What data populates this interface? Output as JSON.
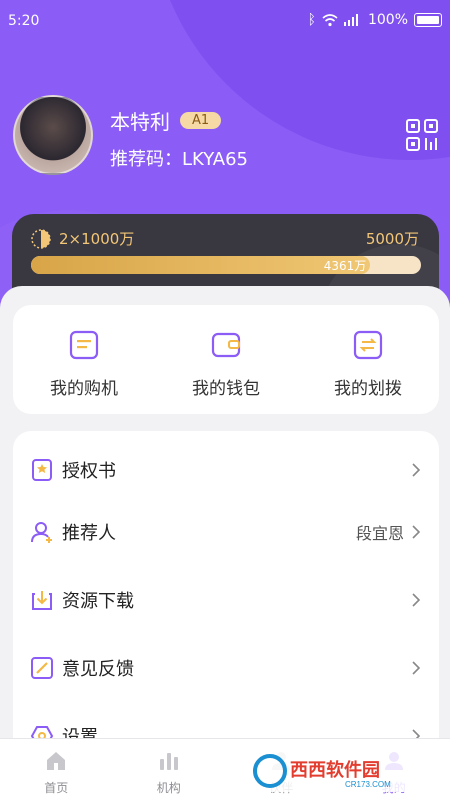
{
  "status": {
    "time": "5:20",
    "battery": "100%"
  },
  "profile": {
    "name": "本特利",
    "level": "A1",
    "referral": "推荐码：LKYA65"
  },
  "membership": {
    "current_label": "2×1000万",
    "target_label": "5000万",
    "progress_label": "4361万",
    "progress_fraction": 0.87
  },
  "quick_actions": [
    {
      "label": "我的购机",
      "icon": "device-icon"
    },
    {
      "label": "我的钱包",
      "icon": "wallet-icon"
    },
    {
      "label": "我的划拨",
      "icon": "transfer-icon"
    }
  ],
  "menu": [
    {
      "label": "授权书",
      "value": "",
      "icon": "certificate-icon"
    },
    {
      "label": "推荐人",
      "value": "段宜恩",
      "icon": "referrer-icon"
    },
    {
      "label": "资源下载",
      "value": "",
      "icon": "download-icon"
    },
    {
      "label": "意见反馈",
      "value": "",
      "icon": "feedback-icon"
    },
    {
      "label": "设置",
      "value": "",
      "icon": "settings-icon"
    }
  ],
  "tabs": [
    {
      "label": "首页",
      "icon": "home-icon",
      "active": false
    },
    {
      "label": "机构",
      "icon": "organization-icon",
      "active": false
    },
    {
      "label": "伙伴",
      "icon": "partner-icon",
      "active": false
    },
    {
      "label": "我的",
      "icon": "profile-icon",
      "active": true
    }
  ],
  "watermark": {
    "text": "西西软件园",
    "url": "CR173.COM"
  },
  "colors": {
    "primary": "#8b5cf6",
    "gold": "#f3c777",
    "dark_card": "#39373f"
  }
}
